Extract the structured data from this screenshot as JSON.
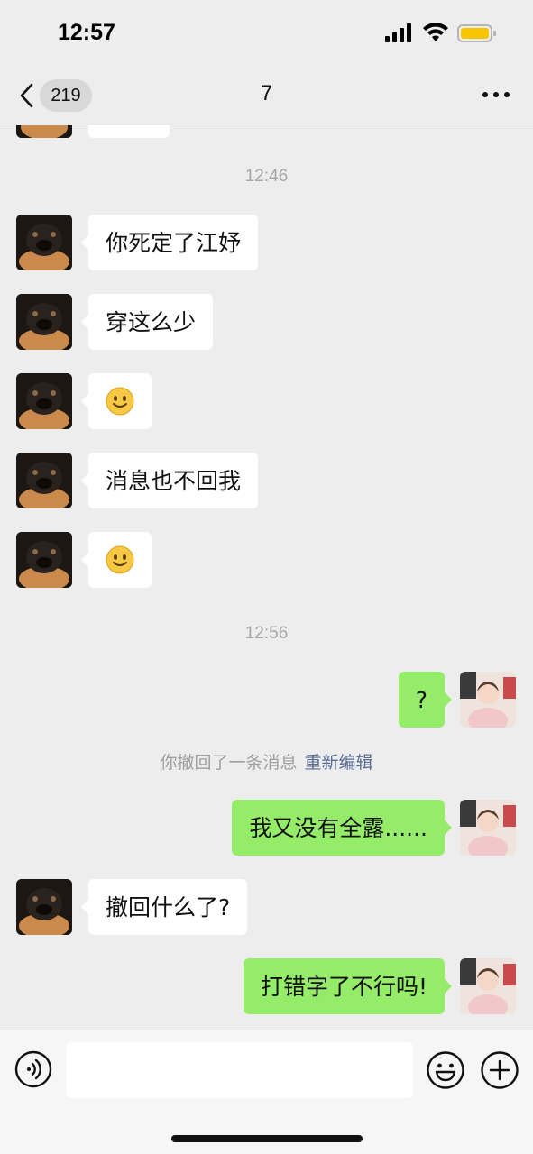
{
  "status_bar": {
    "time": "12:57",
    "battery_color": "#f7c400"
  },
  "nav": {
    "back_count": "219",
    "title": "7",
    "more_icon": "ellipsis-icon"
  },
  "timestamps": [
    "12:46",
    "12:56"
  ],
  "messages": [
    {
      "sender": "other",
      "type": "text",
      "text": "你死定了江妤"
    },
    {
      "sender": "other",
      "type": "text",
      "text": "穿这么少"
    },
    {
      "sender": "other",
      "type": "emoji",
      "emoji": "smile-emoji"
    },
    {
      "sender": "other",
      "type": "text",
      "text": "消息也不回我"
    },
    {
      "sender": "other",
      "type": "emoji",
      "emoji": "smile-emoji"
    },
    {
      "sender": "me",
      "type": "text",
      "text": "?"
    },
    {
      "sender": "me",
      "type": "text",
      "text": "我又没有全露......"
    },
    {
      "sender": "other",
      "type": "text",
      "text": "撤回什么了?"
    },
    {
      "sender": "me",
      "type": "text",
      "text": "打错字了不行吗!"
    }
  ],
  "recall_notice": {
    "text": "你撤回了一条消息",
    "action": "重新编辑"
  },
  "input_bar": {
    "placeholder": "",
    "icons": [
      "voice-icon",
      "emoji-face-icon",
      "plus-icon"
    ]
  },
  "colors": {
    "background": "#ededed",
    "bubble_in": "#ffffff",
    "bubble_out": "#95ec69",
    "link": "#576b95"
  }
}
